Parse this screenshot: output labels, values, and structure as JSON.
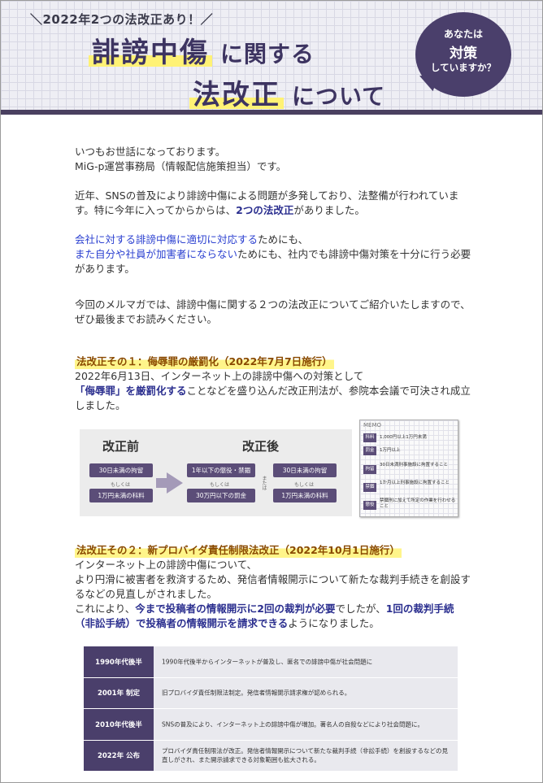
{
  "header": {
    "tag": "＼2022年2つの法改正あり！／",
    "title_hl1": "誹謗中傷",
    "title_rest1": "に関する",
    "title_hl2": "法改正",
    "title_rest2": "について",
    "bubble_line1": "あなたは",
    "bubble_line2": "対策",
    "bubble_line3": "していますか？"
  },
  "intro": {
    "greeting1": "いつもお世話になっております。",
    "greeting2": "MiG-p運営事務局（情報配信施策担当）です。",
    "p2_a": "近年、SNSの普及により誹謗中傷による問題が多発しており、法整備が行われています。特に今年に入ってからからは、",
    "p2_b": "2つの法改正",
    "p2_c": "がありました。",
    "p3_a": "会社に対する誹謗中傷に適切に対応する",
    "p3_b": "ためにも、",
    "p3_c": "また自分や社員が加害者にならない",
    "p3_d": "ためにも、社内でも誹謗中傷対策を十分に行う必要があります。",
    "p4": "今回のメルマガでは、誹謗中傷に関する２つの法改正についてご紹介いたしますので、ぜひ最後までお読みください。"
  },
  "section1": {
    "title": "法改正その１：侮辱罪の厳罰化（2022年7月7日施行）",
    "line1": "2022年6月13日、インターネット上の誹謗中傷への対策として",
    "hl": "「侮辱罪」を厳罰化する",
    "rest": "ことなどを盛り込んだ改正刑法が、参院本会議で可決され成立しました。"
  },
  "diagram": {
    "before_label": "改正前",
    "after_label": "改正後",
    "before_top": "30日未満の拘留",
    "before_or": "もしくは",
    "before_bottom": "1万円未満の科料",
    "after_top_left": "1年以下の懲役・禁錮",
    "after_or_left": "もしくは",
    "after_bottom_left": "30万円以下の罰金",
    "after_vertical": "または",
    "after_top_right": "30日未満の拘留",
    "after_or_right": "もしくは",
    "after_bottom_right": "1万円未満の科料"
  },
  "memo": {
    "title": "MEMO",
    "rows": [
      {
        "k": "科料",
        "v": "1,000円以上1万円未満"
      },
      {
        "k": "罰金",
        "v": "1万円以上"
      },
      {
        "k": "拘留",
        "v": "30日未満刑事施設に拘置すること"
      },
      {
        "k": "禁錮",
        "v": "1か月以上刑事施設に拘置すること"
      },
      {
        "k": "懲役",
        "v": "禁錮刑に加えて所定の作業を行わせること"
      }
    ]
  },
  "section2": {
    "title": "法改正その２：新プロバイダ責任制限法改正（2022年10月1日施行）",
    "line1": "インターネット上の誹謗中傷について、",
    "line2": "より円滑に被害者を救済するため、発信者情報開示について新たな裁判手続きを創設するなどの見直しがされました。",
    "l3_a": "これにより、",
    "l3_b": "今まで投稿者の情報開示に2回の裁判が必要",
    "l3_c": "でしたが、",
    "l3_d": "1回の裁判手続（非訟手続）で投稿者の情報開示を請求できる",
    "l3_e": "ようになりました。"
  },
  "timeline": [
    {
      "label": "1990年代後半",
      "desc": "1990年代後半からインターネットが普及し、匿名での誹謗中傷が社会問題に"
    },
    {
      "label": "2001年 制定",
      "desc": "旧プロバイダ責任制限法制定。発信者情報開示請求権が認められる。"
    },
    {
      "label": "2010年代後半",
      "desc": "SNSの普及により、インターネット上の誹謗中傷が増加。著名人の自殺などにより社会問題に。"
    },
    {
      "label": "2022年 公布",
      "desc": "プロバイダ責任制限法が改正。発信者情報開示について新たな裁判手続（非訟手続）を創設するなどの見直しがされ、また開示請求できる対象範囲も拡大される。"
    }
  ]
}
